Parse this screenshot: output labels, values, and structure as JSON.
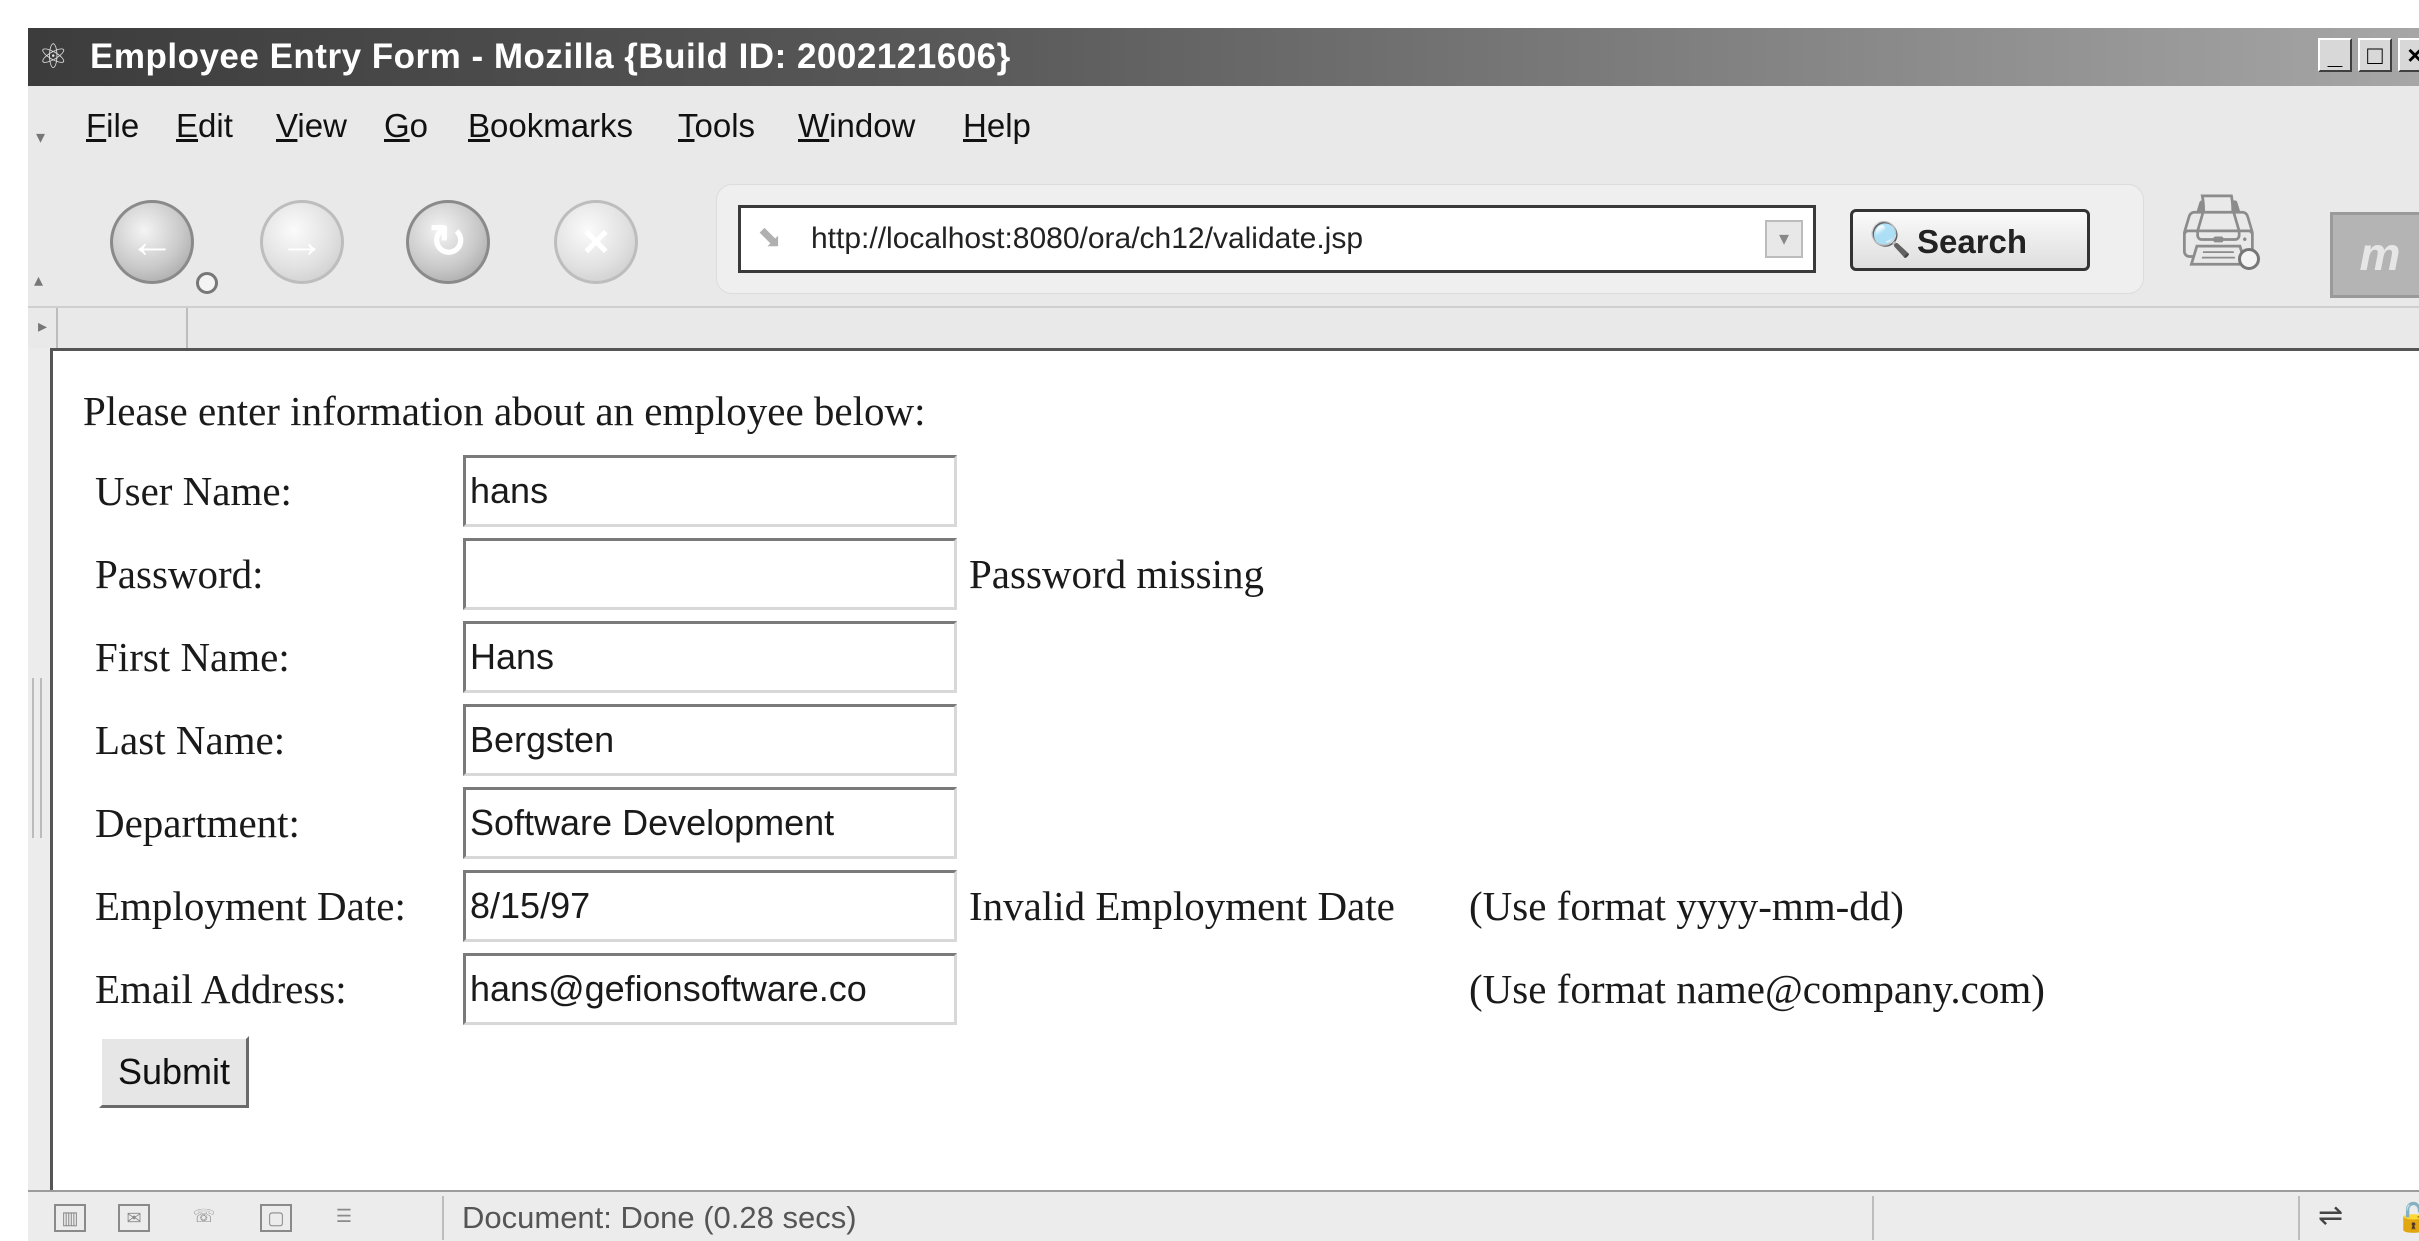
{
  "window": {
    "title": "Employee Entry Form - Mozilla {Build ID: 2002121606}",
    "app_icon": "mozilla-icon",
    "controls": [
      "_",
      "□",
      "×"
    ]
  },
  "menu": {
    "items": [
      {
        "label": "File"
      },
      {
        "label": "Edit"
      },
      {
        "label": "View"
      },
      {
        "label": "Go"
      },
      {
        "label": "Bookmarks"
      },
      {
        "label": "Tools"
      },
      {
        "label": "Window"
      },
      {
        "label": "Help"
      }
    ]
  },
  "toolbar": {
    "back_glyph": "←",
    "forward_glyph": "→",
    "reload_glyph": "↻",
    "stop_glyph": "×",
    "url": "http://localhost:8080/ora/ch12/validate.jsp",
    "search_label": "Search",
    "search_icon": "🔍",
    "print_icon": "🖨",
    "throbber_text": "m"
  },
  "form": {
    "intro": "Please enter information about an employee below:",
    "fields": [
      {
        "label": "User Name:",
        "value": "hans",
        "error": "",
        "hint": ""
      },
      {
        "label": "Password:",
        "value": "",
        "error": "Password missing",
        "hint": ""
      },
      {
        "label": "First Name:",
        "value": "Hans",
        "error": "",
        "hint": ""
      },
      {
        "label": "Last Name:",
        "value": "Bergsten",
        "error": "",
        "hint": ""
      },
      {
        "label": "Department:",
        "value": "Software Development",
        "error": "",
        "hint": ""
      },
      {
        "label": "Employment Date:",
        "value": "8/15/97",
        "error": "Invalid Employment Date",
        "hint": "(Use format yyyy-mm-dd)"
      },
      {
        "label": "Email Address:",
        "value": "hans@gefionsoftware.co",
        "error": "",
        "hint": "(Use format name@company.com)"
      }
    ],
    "submit_label": "Submit"
  },
  "status": {
    "text": "Document: Done (0.28 secs)",
    "icons": [
      "navigator-icon",
      "mail-icon",
      "chat-icon",
      "composer-icon",
      "addressbook-icon"
    ]
  }
}
